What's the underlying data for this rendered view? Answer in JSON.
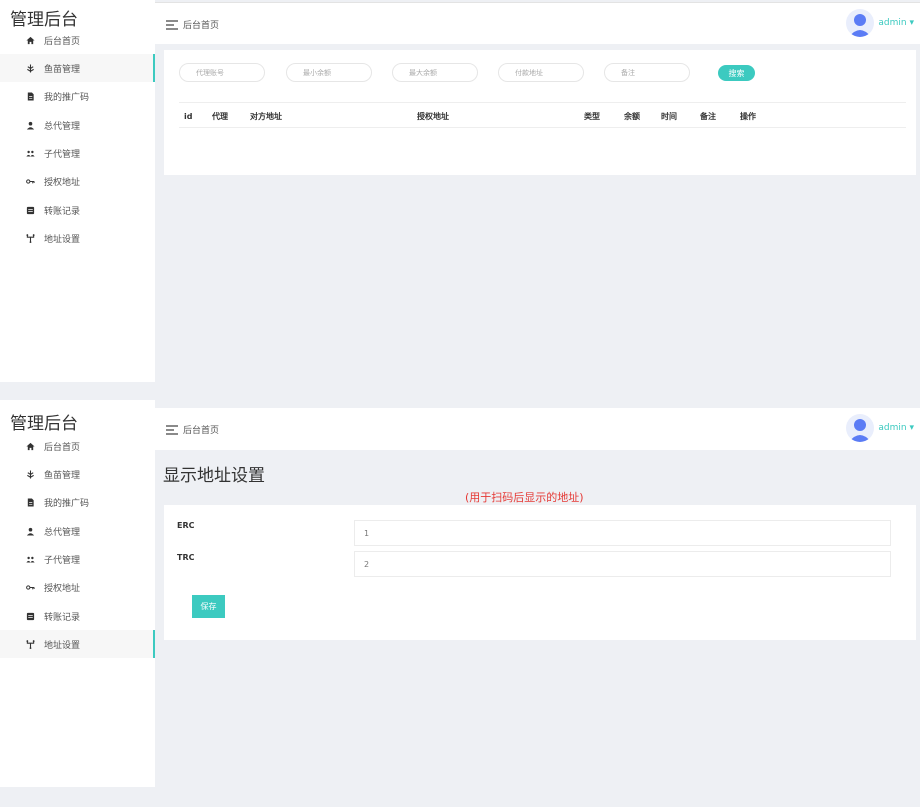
{
  "app_title": "管理后台",
  "sidebar": {
    "items": [
      {
        "label": "后台首页",
        "icon": "home-icon"
      },
      {
        "label": "鱼苗管理",
        "icon": "tree-icon"
      },
      {
        "label": "我的推广码",
        "icon": "file-icon"
      },
      {
        "label": "总代管理",
        "icon": "user-icon"
      },
      {
        "label": "子代管理",
        "icon": "users-icon"
      },
      {
        "label": "授权地址",
        "icon": "key-icon"
      },
      {
        "label": "转账记录",
        "icon": "list-icon"
      },
      {
        "label": "地址设置",
        "icon": "network-icon"
      }
    ]
  },
  "header": {
    "breadcrumb": "后台首页",
    "user": "admin ▾"
  },
  "list_page": {
    "filters": [
      "代理账号",
      "最小余额",
      "最大余额",
      "付款地址",
      "备注"
    ],
    "search_label": "搜索",
    "columns": [
      "id",
      "代理",
      "对方地址",
      "授权地址",
      "类型",
      "余额",
      "时间",
      "备注",
      "操作"
    ]
  },
  "settings_page": {
    "title": "显示地址设置",
    "note": "(用于扫码后显示的地址)",
    "fields": [
      {
        "label": "ERC",
        "value": "1"
      },
      {
        "label": "TRC",
        "value": "2"
      }
    ],
    "save_label": "保存"
  },
  "colors": {
    "accent": "#3ccac0",
    "note": "#e53935",
    "background": "#eef0f4"
  }
}
